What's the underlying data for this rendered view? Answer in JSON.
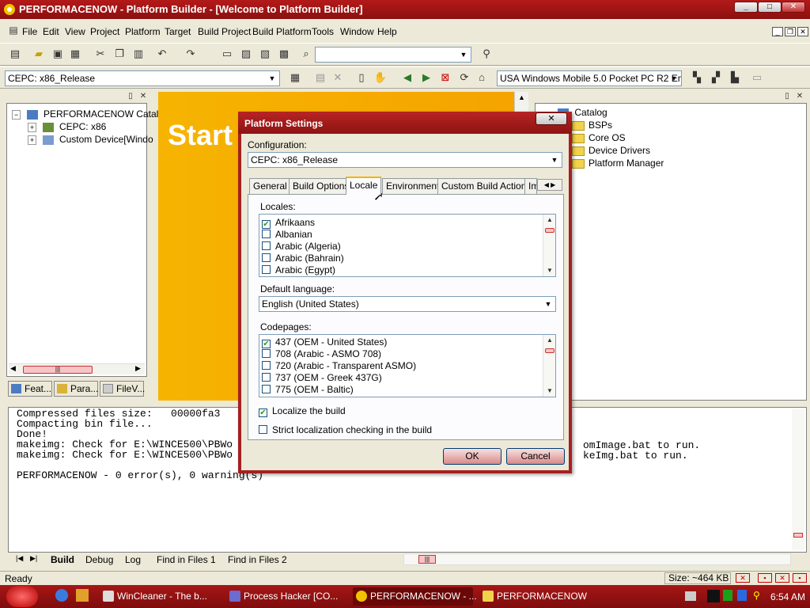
{
  "window": {
    "title": "PERFORMACENOW - Platform Builder - [Welcome to Platform Builder]",
    "controls": {
      "minimize": "_",
      "maximize": "□",
      "close": "✕"
    }
  },
  "menu": [
    "File",
    "Edit",
    "View",
    "Project",
    "Platform",
    "Target",
    "Build Project",
    "Build Platform",
    "Tools",
    "Window",
    "Help"
  ],
  "toolbar": {
    "config_combo": "CEPC: x86_Release",
    "sdk_combo": "USA Windows Mobile 5.0 Pocket PC R2 Em",
    "find_combo": ""
  },
  "left_panel": {
    "tree": [
      {
        "label": "PERFORMACENOW Catal"
      },
      {
        "label": "CEPC: x86"
      },
      {
        "label": "Custom Device[Windo"
      }
    ],
    "tabs": [
      "Feat...",
      "Para...",
      "FileV..."
    ]
  },
  "start_page": {
    "heading": "Start"
  },
  "catalog": {
    "root": "Catalog",
    "items": [
      "BSPs",
      "Core OS",
      "Device Drivers",
      "Platform Manager"
    ]
  },
  "output": {
    "lines": [
      "Compressed files size:   00000fa3",
      "Compacting bin file...",
      "Done!",
      "makeimg: Check for E:\\WINCE500\\PBWo",
      "makeimg: Check for E:\\WINCE500\\PBWo",
      "",
      "PERFORMACENOW - 0 error(s), 0 warning(s)"
    ],
    "right_lines": [
      "omImage.bat to run.",
      "keImg.bat to run."
    ],
    "tabs": [
      "Build",
      "Debug",
      "Log",
      "Find in Files 1",
      "Find in Files 2"
    ]
  },
  "status": {
    "text": "Ready",
    "size": "Size: ~464 KB"
  },
  "dialog": {
    "title": "Platform Settings",
    "close": "✕",
    "configuration_label": "Configuration:",
    "configuration_value": "CEPC: x86_Release",
    "tabs": [
      "General",
      "Build Options",
      "Locale",
      "Environment",
      "Custom Build Actions",
      "Im"
    ],
    "active_tab": "Locale",
    "locales_label": "Locales:",
    "locales": [
      {
        "label": "Afrikaans",
        "checked": true
      },
      {
        "label": "Albanian",
        "checked": false
      },
      {
        "label": "Arabic (Algeria)",
        "checked": false
      },
      {
        "label": "Arabic (Bahrain)",
        "checked": false
      },
      {
        "label": "Arabic (Egypt)",
        "checked": false
      }
    ],
    "default_language_label": "Default language:",
    "default_language": "English (United States)",
    "codepages_label": "Codepages:",
    "codepages": [
      {
        "label": "437  (OEM - United States)",
        "checked": true
      },
      {
        "label": "708  (Arabic - ASMO 708)",
        "checked": false
      },
      {
        "label": "720  (Arabic - Transparent ASMO)",
        "checked": false
      },
      {
        "label": "737  (OEM - Greek 437G)",
        "checked": false
      },
      {
        "label": "775  (OEM - Baltic)",
        "checked": false
      }
    ],
    "localize_label": "Localize the build",
    "localize_checked": true,
    "strict_label": "Strict localization checking in the build",
    "strict_checked": false,
    "ok": "OK",
    "cancel": "Cancel"
  },
  "taskbar": {
    "tasks": [
      "WinCleaner - The b...",
      "Process Hacker [CO...",
      "PERFORMACENOW - ...",
      "PERFORMACENOW"
    ],
    "clock": "6:54 AM"
  },
  "colors": {
    "titlebar": "#a01818",
    "start_page": "#f5a800",
    "taskbar": "#8e1111"
  }
}
